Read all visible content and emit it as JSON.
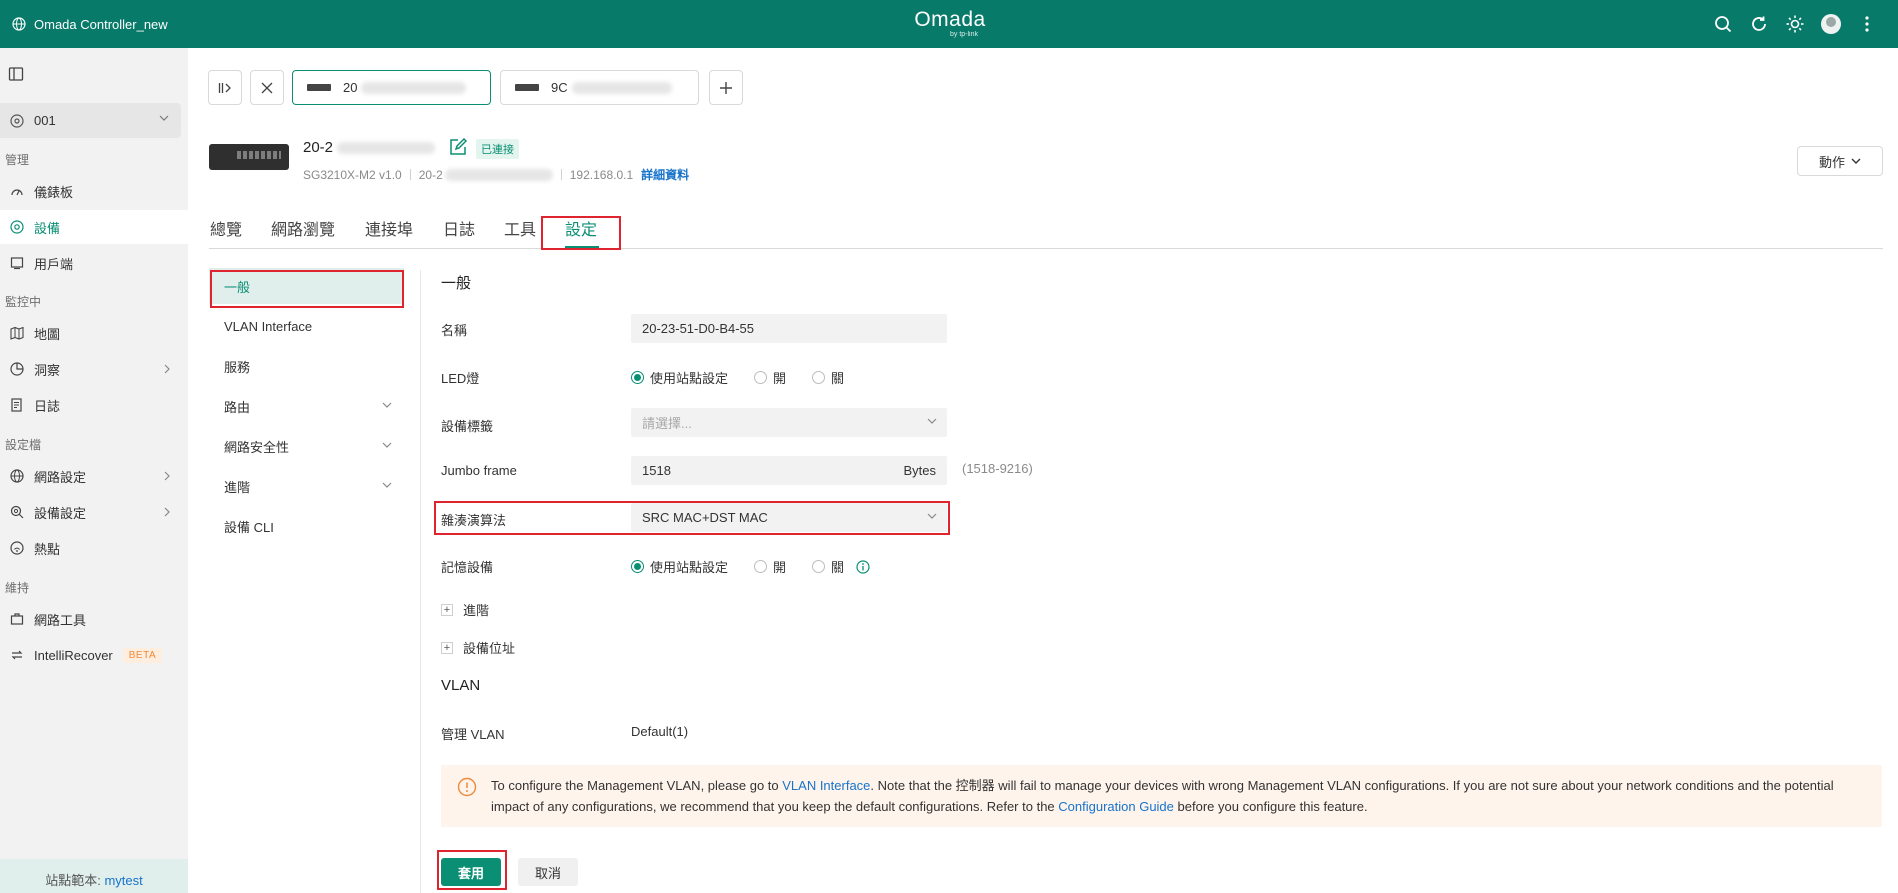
{
  "app": {
    "title": "Omada Controller_new",
    "logo": "Omada",
    "logo_sub": "by tp-link"
  },
  "topbar": {
    "icons": [
      "search-icon",
      "refresh-icon",
      "brightness-icon",
      "avatar",
      "more-icon"
    ]
  },
  "sidebar": {
    "site": "001",
    "sections": {
      "manage": "管理",
      "monitor": "監控中",
      "profiles": "設定檔",
      "maintain": "維持"
    },
    "items": [
      {
        "label": "儀錶板",
        "icon": "dashboard-icon"
      },
      {
        "label": "設備",
        "icon": "devices-icon",
        "active": true
      },
      {
        "label": "用戶端",
        "icon": "clients-icon"
      },
      {
        "label": "地圖",
        "icon": "map-icon"
      },
      {
        "label": "洞察",
        "icon": "insight-icon"
      },
      {
        "label": "日誌",
        "icon": "log-icon"
      },
      {
        "label": "網路設定",
        "icon": "globe-icon"
      },
      {
        "label": "設備設定",
        "icon": "device-config-icon"
      },
      {
        "label": "熱點",
        "icon": "hotspot-icon"
      },
      {
        "label": "網路工具",
        "icon": "toolbox-icon"
      },
      {
        "label": "IntelliRecover",
        "icon": "recover-icon",
        "badge": "BETA"
      }
    ],
    "footer": {
      "prefix": "站點範本: ",
      "link": "mytest"
    }
  },
  "device_tabs": [
    {
      "prefix": "20",
      "active": true
    },
    {
      "prefix": "9C",
      "active": false
    }
  ],
  "device": {
    "name_prefix": "20-2",
    "status": "已連接",
    "model": "SG3210X-M2 v1.0",
    "mac_prefix": "20-2",
    "ip": "192.168.0.1",
    "details_link": "詳細資料",
    "action": "動作"
  },
  "tabs": [
    "總覽",
    "網路瀏覽",
    "連接埠",
    "日誌",
    "工具",
    "設定"
  ],
  "subnav": [
    {
      "label": "一般",
      "active": true
    },
    {
      "label": "VLAN Interface"
    },
    {
      "label": "服務"
    },
    {
      "label": "路由",
      "expandable": true
    },
    {
      "label": "網路安全性",
      "expandable": true
    },
    {
      "label": "進階",
      "expandable": true
    },
    {
      "label": "設備 CLI"
    }
  ],
  "general": {
    "title": "一般",
    "name_label": "名稱",
    "name_value": "20-23-51-D0-B4-55",
    "led_label": "LED燈",
    "led_options": [
      "使用站點設定",
      "開",
      "關"
    ],
    "led_selected": 0,
    "tag_label": "設備標籤",
    "tag_placeholder": "請選擇...",
    "jumbo_label": "Jumbo frame",
    "jumbo_value": "1518",
    "jumbo_unit": "Bytes",
    "jumbo_range": "(1518-9216)",
    "hash_label": "雜湊演算法",
    "hash_value": "SRC MAC+DST MAC",
    "memory_label": "記憶設備",
    "memory_options": [
      "使用站點設定",
      "開",
      "關"
    ],
    "memory_selected": 0,
    "advanced": "進階",
    "location": "設備位址"
  },
  "vlan": {
    "title": "VLAN",
    "mgmt_label": "管理 VLAN",
    "mgmt_value": "Default(1)",
    "alert": {
      "t1": "To configure the Management VLAN, please go to ",
      "link1": "VLAN Interface",
      "t2": ". Note that the 控制器 will fail to manage your devices with wrong Management VLAN configurations. If you are not sure about your network conditions and the potential impact of any configurations, we recommend that you keep the default configurations. Refer to the ",
      "link2": "Configuration Guide",
      "t3": " before you configure this feature."
    }
  },
  "buttons": {
    "apply": "套用",
    "cancel": "取消"
  },
  "colors": {
    "topbar": "#077a69",
    "accent": "#0a8f74",
    "highlight": "#e0242f",
    "link": "#1773cc"
  }
}
